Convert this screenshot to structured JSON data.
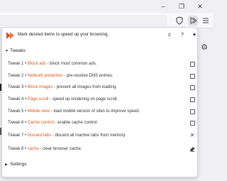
{
  "browser": {
    "window_buttons": {
      "minimize": "–",
      "restore": "❐",
      "close": "✕"
    },
    "toolbar_icons": [
      "shield-icon",
      "extension-icon",
      "menu-icon"
    ]
  },
  "panel": {
    "header": {
      "title": "Mark desired items to speed up your browsing.",
      "buttons": [
        "c",
        "?",
        "♥"
      ]
    },
    "tweaks_label": "Tweaks",
    "settings_label": "Settings",
    "tweaks": [
      {
        "prefix": "Tweak 1 •",
        "name": "Block ads",
        "desc": "- block most common ads.",
        "control": "checkbox"
      },
      {
        "prefix": "Tweak 2 •",
        "name": "Network prediction",
        "desc": "- pre-resolve DNS entries.",
        "control": "checkbox"
      },
      {
        "prefix": "Tweak 3 •",
        "name": "Block images",
        "desc": "- prevent all images from loading.",
        "control": "checkbox"
      },
      {
        "prefix": "Tweak 4 •",
        "name": "Page scroll",
        "desc": "- speed up rendering on page scroll.",
        "control": "checkbox"
      },
      {
        "prefix": "Tweak 5 •",
        "name": "Mobile view",
        "desc": "- load mobile version of sites to improve speed.",
        "control": "checkbox"
      },
      {
        "prefix": "Tweak 6 •",
        "name": "Cache control",
        "desc": "- enable cache control.",
        "control": "checkbox"
      },
      {
        "prefix": "Tweak 7 •",
        "name": "Discard tabs",
        "desc": "- discard all inactive tabs from memory.",
        "control": "close-icon"
      },
      {
        "prefix": "Tweak 8 •",
        "name": "cache",
        "desc": "- clear browser cache.",
        "control": "eraser-icon"
      }
    ]
  },
  "colors": {
    "accent": "#e0541c",
    "logo": "#d9531e"
  }
}
